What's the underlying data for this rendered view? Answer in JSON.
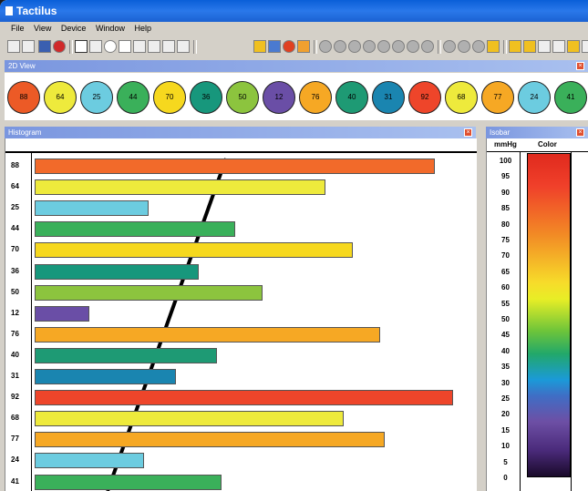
{
  "window": {
    "title": "Tactilus"
  },
  "menu": [
    {
      "label": "File"
    },
    {
      "label": "View"
    },
    {
      "label": "Device"
    },
    {
      "label": "Window"
    },
    {
      "label": "Help"
    }
  ],
  "view2d": {
    "title": "2D View",
    "sensors": [
      {
        "value": "88",
        "color": "#ec5a26"
      },
      {
        "value": "64",
        "color": "#eeea3c"
      },
      {
        "value": "25",
        "color": "#6ccce0"
      },
      {
        "value": "44",
        "color": "#3ab05a"
      },
      {
        "value": "70",
        "color": "#f6d81e"
      },
      {
        "value": "36",
        "color": "#17977c"
      },
      {
        "value": "50",
        "color": "#8cc43e"
      },
      {
        "value": "12",
        "color": "#6a4ea6"
      },
      {
        "value": "76",
        "color": "#f6a824"
      },
      {
        "value": "40",
        "color": "#1e9a74"
      },
      {
        "value": "31",
        "color": "#1a85b0"
      },
      {
        "value": "92",
        "color": "#ee452a"
      },
      {
        "value": "68",
        "color": "#eeea3c"
      },
      {
        "value": "77",
        "color": "#f6a824"
      },
      {
        "value": "24",
        "color": "#6ccce0"
      },
      {
        "value": "41",
        "color": "#3ab05a"
      }
    ]
  },
  "histogram": {
    "title": "Histogram",
    "chart_data": {
      "type": "bar",
      "categories": [
        "88",
        "64",
        "25",
        "44",
        "70",
        "36",
        "50",
        "12",
        "76",
        "40",
        "31",
        "92",
        "68",
        "77",
        "24",
        "41"
      ],
      "values": [
        88,
        64,
        25,
        44,
        70,
        36,
        50,
        12,
        76,
        40,
        31,
        92,
        68,
        77,
        24,
        41
      ],
      "colors": [
        "#f26a2a",
        "#eeea3c",
        "#6ccce0",
        "#3ab05a",
        "#f6d81e",
        "#17977c",
        "#8cc43e",
        "#6a4ea6",
        "#f6a824",
        "#1e9a74",
        "#1a85b0",
        "#ee452a",
        "#eeea3c",
        "#f6a824",
        "#6ccce0",
        "#3ab05a"
      ]
    }
  },
  "isobar": {
    "title": "Isobar",
    "unit_header": "mmHg",
    "color_header": "Color",
    "values": [
      "100",
      "95",
      "90",
      "85",
      "80",
      "75",
      "70",
      "65",
      "60",
      "55",
      "50",
      "45",
      "40",
      "35",
      "30",
      "25",
      "20",
      "15",
      "10",
      "5",
      "0"
    ]
  },
  "toolbar_icons": [
    "new-icon",
    "open-icon",
    "save-icon",
    "stop-icon",
    "pointer-icon",
    "pen-icon",
    "ellipse-icon",
    "rect-select-icon",
    "lasso-icon",
    "line-icon",
    "zoom-icon",
    "eraser-icon",
    "grid-icon",
    "table-icon",
    "color-icon",
    "image-icon",
    "playback-buttons",
    "2d-icon",
    "column-icon",
    "chart-icon",
    "report-icon",
    "letter-a-icon",
    "export-icon"
  ]
}
